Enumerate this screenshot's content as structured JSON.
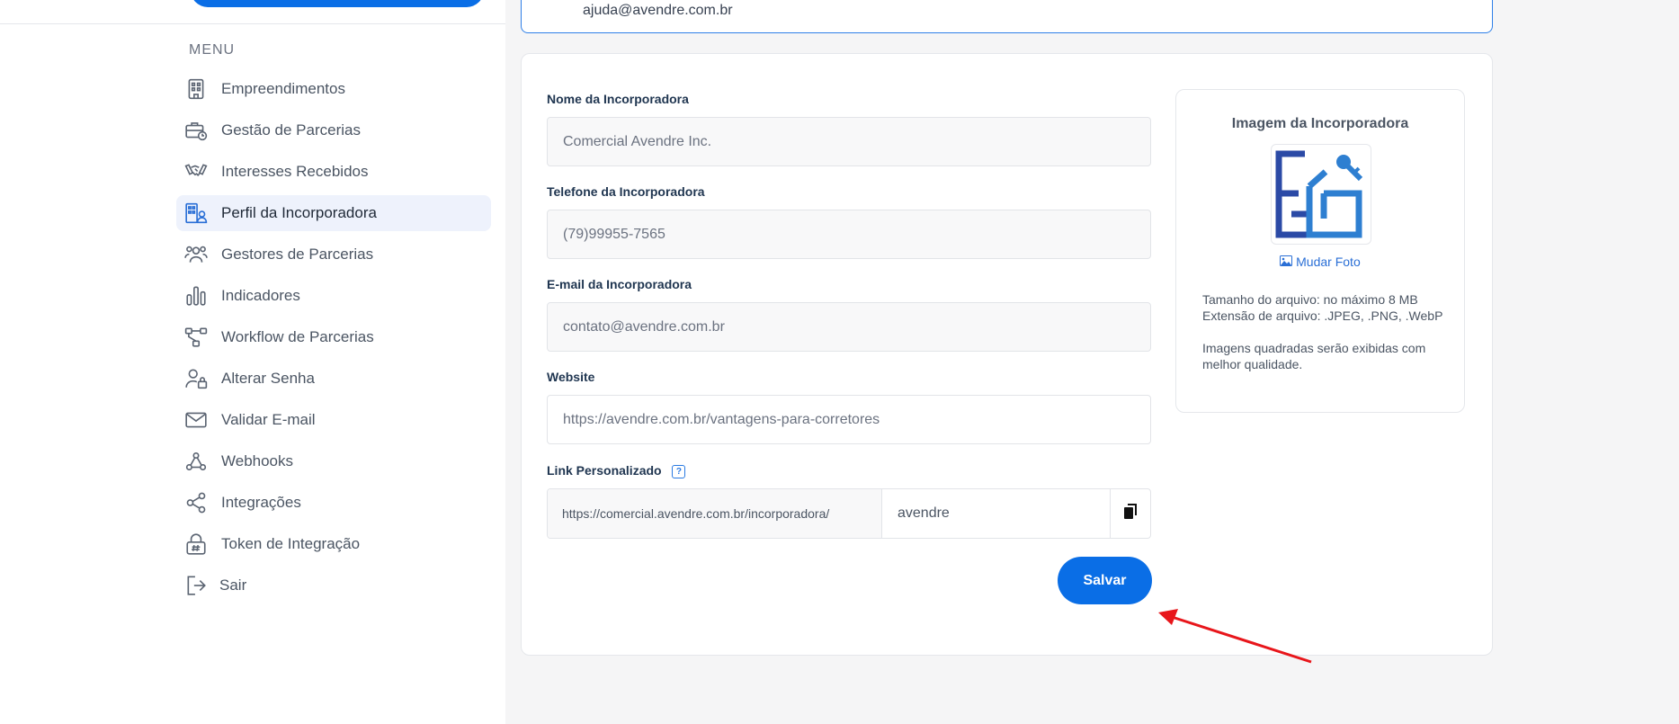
{
  "top_card": {
    "email": "ajuda@avendre.com.br"
  },
  "menu": {
    "heading": "MENU",
    "items": [
      {
        "label": "Empreendimentos",
        "icon": "building-icon",
        "active": false
      },
      {
        "label": "Gestão de Parcerias",
        "icon": "briefcase-clock-icon",
        "active": false
      },
      {
        "label": "Interesses Recebidos",
        "icon": "handshake-icon",
        "active": false
      },
      {
        "label": "Perfil da Incorporadora",
        "icon": "company-profile-icon",
        "active": true
      },
      {
        "label": "Gestores de Parcerias",
        "icon": "users-icon",
        "active": false
      },
      {
        "label": "Indicadores",
        "icon": "bar-chart-icon",
        "active": false
      },
      {
        "label": "Workflow de Parcerias",
        "icon": "workflow-icon",
        "active": false
      },
      {
        "label": "Alterar Senha",
        "icon": "user-lock-icon",
        "active": false
      },
      {
        "label": "Validar E-mail",
        "icon": "mail-icon",
        "active": false
      },
      {
        "label": "Webhooks",
        "icon": "webhook-icon",
        "active": false
      },
      {
        "label": "Integrações",
        "icon": "share-icon",
        "active": false
      },
      {
        "label": "Token de Integração",
        "icon": "lock-hash-icon",
        "active": false
      }
    ],
    "exit_label": "Sair"
  },
  "form": {
    "name_label": "Nome da Incorporadora",
    "name_value": "Comercial Avendre Inc.",
    "phone_label": "Telefone da Incorporadora",
    "phone_value": "(79)99955-7565",
    "email_label": "E-mail da Incorporadora",
    "email_value": "contato@avendre.com.br",
    "website_label": "Website",
    "website_value": "https://avendre.com.br/vantagens-para-corretores",
    "link_label": "Link Personalizado",
    "link_prefix": "https://comercial.avendre.com.br/incorporadora/",
    "link_slug": "avendre",
    "save_label": "Salvar"
  },
  "image_panel": {
    "title": "Imagem da Incorporadora",
    "change_photo": "Mudar Foto",
    "size_info": "Tamanho do arquivo: no máximo 8 MB",
    "extension_info": "Extensão de arquivo: .JPEG, .PNG, .WebP",
    "quality_info": "Imagens quadradas serão exibidas com melhor qualidade."
  },
  "colors": {
    "primary": "#0a6ee6",
    "active_bg": "#eef2fc",
    "annotation_arrow": "#e8161b"
  }
}
